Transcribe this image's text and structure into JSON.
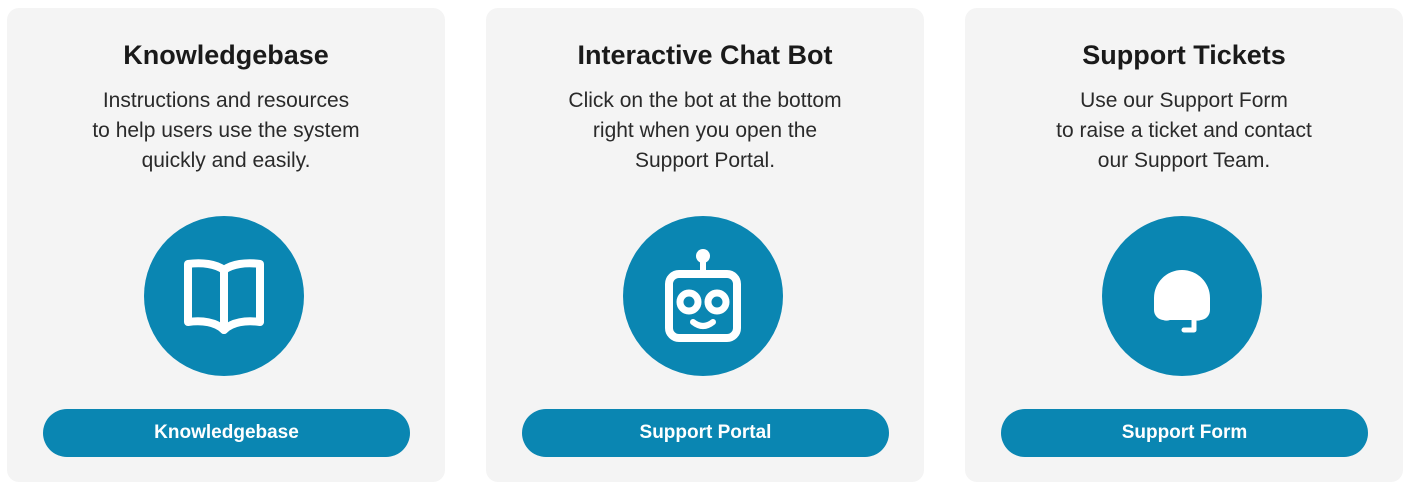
{
  "cards": [
    {
      "title": "Knowledgebase",
      "description": "Instructions and resources\nto help users use the system\nquickly and easily.",
      "icon": "book-icon",
      "button_label": "Knowledgebase"
    },
    {
      "title": "Interactive Chat Bot",
      "description": "Click on the bot at the bottom\nright when you open the\nSupport Portal.",
      "icon": "robot-icon",
      "button_label": "Support Portal"
    },
    {
      "title": "Support Tickets",
      "description": "Use our Support Form\nto raise a ticket and contact\nour Support Team.",
      "icon": "headset-icon",
      "button_label": "Support Form"
    }
  ],
  "colors": {
    "accent": "#0a86b2",
    "card_background": "#f4f4f4",
    "title_text": "#1a1a1a",
    "button_text": "#ffffff"
  }
}
